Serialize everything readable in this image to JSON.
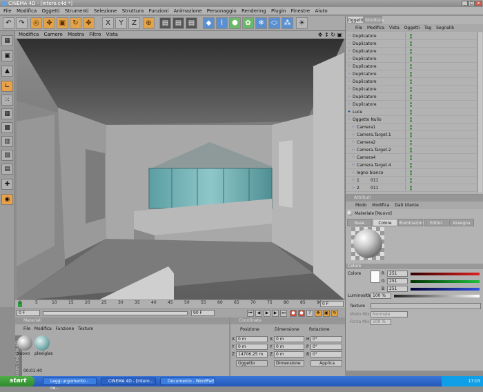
{
  "window": {
    "title": "CINEMA 4D - [intero.c4d *]",
    "min": "_",
    "max": "□",
    "close": "x"
  },
  "menu": [
    "File",
    "Modifica",
    "Oggetti",
    "Strumenti",
    "Selezione",
    "Struttura",
    "Funzioni",
    "Animazione",
    "Personaggio",
    "Rendering",
    "Plugin",
    "Finestre",
    "Aiuto"
  ],
  "toolbar_axes": [
    "X",
    "Y",
    "Z"
  ],
  "viewport": {
    "menu": [
      "Modifica",
      "Camere",
      "Mostra",
      "Filtro",
      "Vista"
    ]
  },
  "timeline": {
    "ticks": [
      "0",
      "5",
      "10",
      "15",
      "20",
      "25",
      "30",
      "35",
      "40",
      "45",
      "50",
      "55",
      "60",
      "65",
      "70",
      "75",
      "80",
      "85",
      "90"
    ],
    "start_field": "0 F",
    "end_field": "90 F",
    "current_field": "0 F"
  },
  "material_manager": {
    "header": "Materiali",
    "menu": [
      "File",
      "Modifica",
      "Funzione",
      "Texture"
    ],
    "materials": [
      {
        "label": "Nuovo"
      },
      {
        "label": "plexiglas"
      }
    ],
    "time": "00:01:40"
  },
  "coordinates": {
    "header": "Coordinate",
    "columns": [
      "Posizione",
      "Dimensione",
      "Rotazione"
    ],
    "rows": [
      {
        "axis": "X",
        "pos": "0 m",
        "dim": "0 m",
        "rot_axis": "H",
        "rot": "0°"
      },
      {
        "axis": "Y",
        "pos": "0 m",
        "dim": "0 m",
        "rot_axis": "P",
        "rot": "0°"
      },
      {
        "axis": "Z",
        "pos": "14706.25 m",
        "dim": "0 m",
        "rot_axis": "B",
        "rot": "0°"
      }
    ],
    "dropdown1": "Oggetto",
    "dropdown2": "Dimensione",
    "apply": "Applica"
  },
  "object_manager": {
    "tabs": [
      "Oggetti",
      "Struttura"
    ],
    "menu": [
      "File",
      "Modifica",
      "Vista",
      "Oggetti",
      "Tag",
      "Segnalib"
    ],
    "items": [
      {
        "name": "Duplicatore",
        "indent": 0
      },
      {
        "name": "Duplicatore",
        "indent": 0
      },
      {
        "name": "Duplicatore",
        "indent": 0
      },
      {
        "name": "Duplicatore",
        "indent": 0
      },
      {
        "name": "Duplicatore",
        "indent": 0
      },
      {
        "name": "Duplicatore",
        "indent": 0
      },
      {
        "name": "Duplicatore",
        "indent": 0
      },
      {
        "name": "Duplicatore",
        "indent": 0
      },
      {
        "name": "Duplicatore",
        "indent": 0
      },
      {
        "name": "Duplicatore",
        "indent": 0
      },
      {
        "name": "Luce",
        "indent": 0
      },
      {
        "name": "Oggetto Nullo",
        "indent": 0
      },
      {
        "name": "Camera1",
        "indent": 1
      },
      {
        "name": "Camera.Target.1",
        "indent": 1
      },
      {
        "name": "Camera2",
        "indent": 1
      },
      {
        "name": "Camera.Target.2",
        "indent": 1
      },
      {
        "name": "Camera4",
        "indent": 1
      },
      {
        "name": "Camera.Target.4",
        "indent": 1
      },
      {
        "name": "legno bianco",
        "indent": 1
      },
      {
        "name": "1",
        "indent": 1
      },
      {
        "name": "2",
        "indent": 1
      }
    ],
    "row_ids": [
      "011",
      "011"
    ]
  },
  "attributes": {
    "header": "Attributi",
    "menu": [
      "Modo",
      "Modifica",
      "Dati Utente"
    ],
    "material_name": "Materiale [Nuovo]",
    "tabs": [
      "Base",
      "Colore",
      "Illuminazione",
      "Editor",
      "Assegna"
    ],
    "active_tab": "Colore",
    "section": "Colore",
    "color_label": "Colore",
    "rgb": [
      {
        "ch": "R",
        "val": "251"
      },
      {
        "ch": "G",
        "val": "251"
      },
      {
        "ch": "B",
        "val": "251"
      }
    ],
    "luminosity_label": "Luminosità",
    "luminosity": "100 %",
    "texture_label": "Texture",
    "mix_mode_label": "Modo Mix",
    "mix_mode": "Normale",
    "mix_strength_label": "Forza Mix",
    "mix_strength": "100 %"
  },
  "taskbar": {
    "start": "start",
    "tasks": [
      "Leggi argomento - ne...",
      "CINEMA 4D - [intero...",
      "Documento - WordPad"
    ],
    "clock": "17:03"
  }
}
